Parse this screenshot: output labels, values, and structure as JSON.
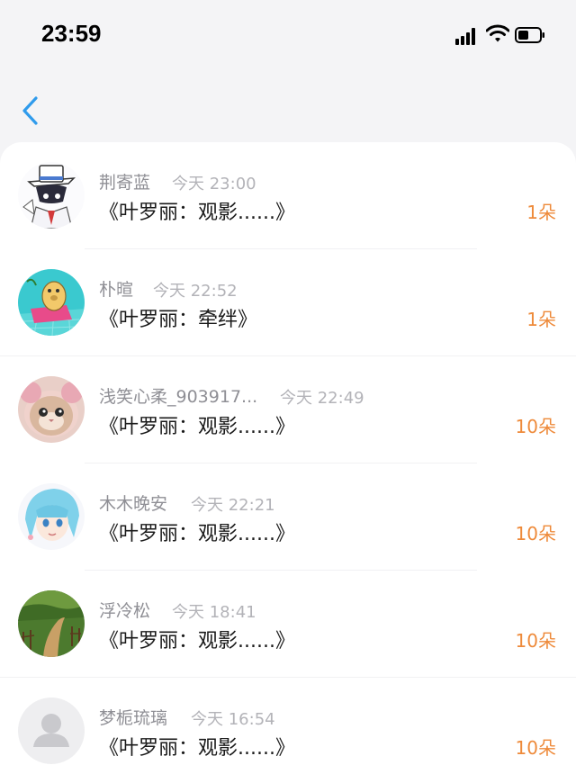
{
  "status_bar": {
    "time": "23:59"
  },
  "nav": {
    "back_icon": "chevron-left-icon",
    "accent": "#2f9bec"
  },
  "colors": {
    "count": "#ee8a3a",
    "name": "#8f8f95",
    "timestamp": "#b3b3b8"
  },
  "items": [
    {
      "name": "荆寄蓝",
      "time": "今天 23:00",
      "title": "《叶罗丽：观影......》",
      "count": "1朵",
      "avatar": "cartoon-character-avatar"
    },
    {
      "name": "朴暄",
      "time": "今天 22:52",
      "title": "《叶罗丽：牵绊》",
      "count": "1朵",
      "avatar": "cartoon-bear-avatar"
    },
    {
      "name": "浅笑心柔_903917...",
      "time": "今天 22:49",
      "title": "《叶罗丽：观影......》",
      "count": "10朵",
      "avatar": "cat-avatar"
    },
    {
      "name": "木木晚安",
      "time": "今天 22:21",
      "title": "《叶罗丽：观影......》",
      "count": "10朵",
      "avatar": "anime-girl-avatar"
    },
    {
      "name": "浮冷松",
      "time": "今天 18:41",
      "title": "《叶罗丽：观影......》",
      "count": "10朵",
      "avatar": "landscape-path-avatar"
    },
    {
      "name": "梦栀琉璃",
      "time": "今天 16:54",
      "title": "《叶罗丽：观影......》",
      "count": "10朵",
      "avatar": "default-user-avatar"
    }
  ]
}
